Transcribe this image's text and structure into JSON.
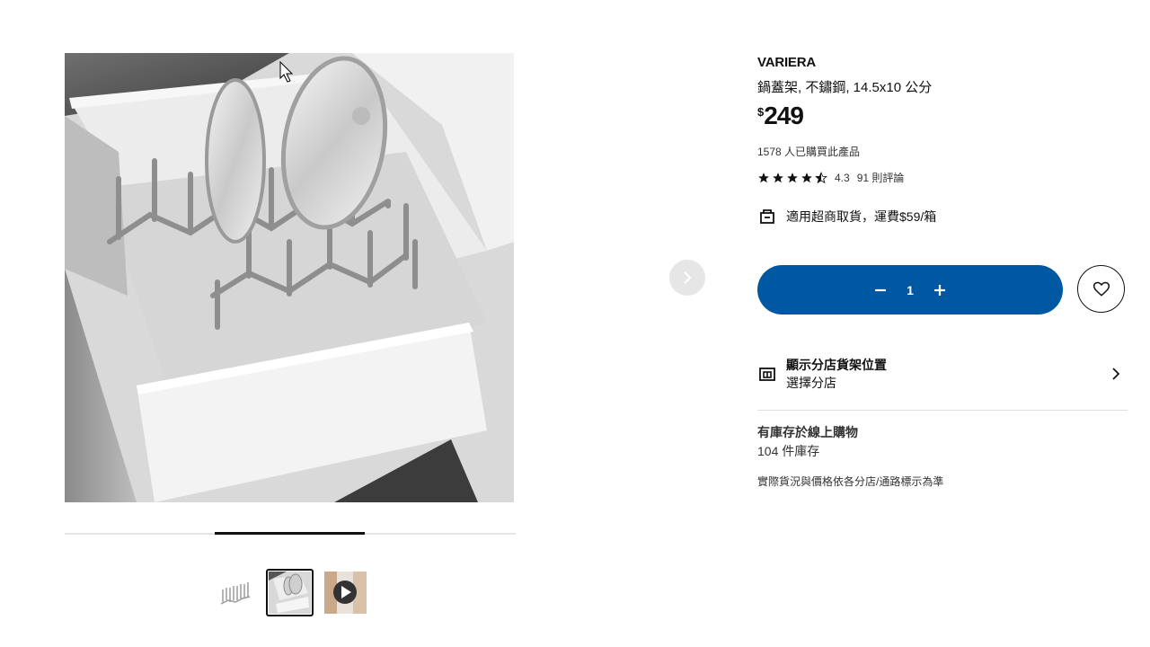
{
  "product": {
    "name": "VARIERA",
    "description": "鍋蓋架, 不鏽鋼, 14.5x10 公分",
    "currency_symbol": "$",
    "price": "249",
    "purchased_text": "1578 人已購買此產品",
    "rating": {
      "stars": 4.3,
      "score_text": "4.3",
      "reviews_text": "91 則評論"
    },
    "delivery_text": "適用超商取貨，運費$59/箱"
  },
  "quantity": {
    "value": "1",
    "decrease_icon": "minus-icon",
    "increase_icon": "plus-icon"
  },
  "favourite": {
    "icon": "heart-icon"
  },
  "store": {
    "title": "顯示分店貨架位置",
    "subtitle": "選擇分店",
    "icon": "store-icon"
  },
  "stock": {
    "title": "有庫存於線上購物",
    "count": "104 件庫存",
    "note": "實際貨況與價格依各分店/通路標示為準"
  },
  "gallery": {
    "thumbnails": [
      "product-thumbnail",
      "in-use-thumbnail",
      "video-thumbnail"
    ],
    "selected_index": 1,
    "progress": "2/3"
  },
  "colors": {
    "primary": "#0058a3",
    "text": "#111111",
    "muted": "#333333"
  }
}
